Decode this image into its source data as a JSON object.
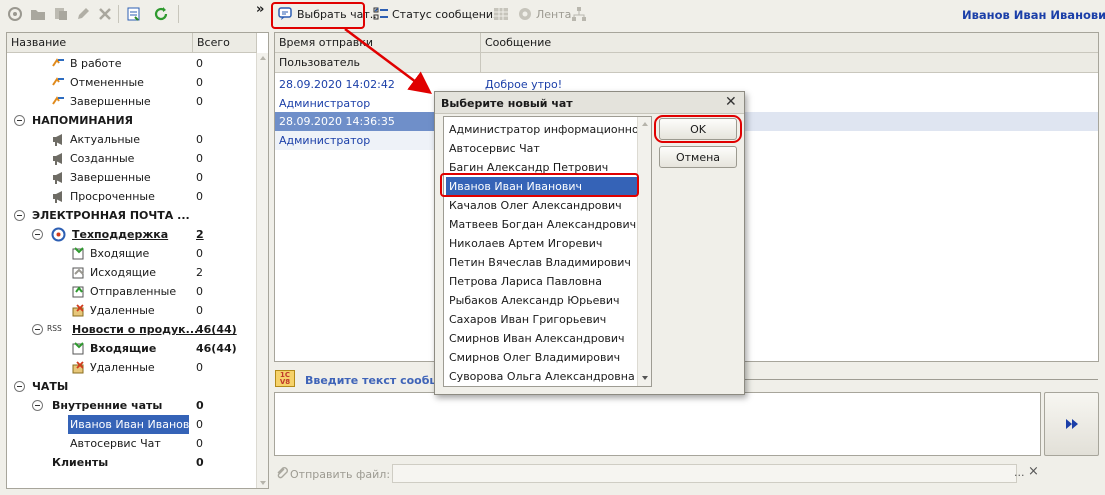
{
  "toolbar": {
    "choose_chat_label": "Выбрать чат..",
    "message_status_label": "Статус сообщения",
    "feed_label": "Лента",
    "more_glyph": "»",
    "user_name": "Иванов Иван Иванович"
  },
  "left_panel": {
    "col_name": "Название",
    "col_total": "Всего",
    "rows": [
      {
        "label": "В работе",
        "count": "0"
      },
      {
        "label": "Отмененные",
        "count": "0"
      },
      {
        "label": "Завершенные",
        "count": "0"
      },
      {
        "label": "НАПОМИНАНИЯ",
        "count": ""
      },
      {
        "label": "Актуальные",
        "count": "0"
      },
      {
        "label": "Созданные",
        "count": "0"
      },
      {
        "label": "Завершенные",
        "count": "0"
      },
      {
        "label": "Просроченные",
        "count": "0"
      },
      {
        "label": "ЭЛЕКТРОННАЯ ПОЧТА ...",
        "count": ""
      },
      {
        "label": "Техподдержка",
        "count": "2"
      },
      {
        "label": "Входящие",
        "count": "0"
      },
      {
        "label": "Исходящие",
        "count": "2"
      },
      {
        "label": "Отправленные",
        "count": "0"
      },
      {
        "label": "Удаленные",
        "count": "0"
      },
      {
        "label": "Новости о продук...",
        "count": "46(44)"
      },
      {
        "label": "Входящие",
        "count": "46(44)"
      },
      {
        "label": "Удаленные",
        "count": "0"
      },
      {
        "label": "ЧАТЫ",
        "count": ""
      },
      {
        "label": "Внутренние чаты",
        "count": "0"
      },
      {
        "label": "Иванов Иван Иванов...",
        "count": "0"
      },
      {
        "label": "Автосервис Чат",
        "count": "0"
      },
      {
        "label": "Клиенты",
        "count": "0"
      }
    ],
    "rss_label": "RSS"
  },
  "grid": {
    "col_time": "Время отправки",
    "col_user": "Пользователь",
    "col_message": "Сообщение",
    "messages": [
      {
        "time": "28.09.2020 14:02:42",
        "user": "Администратор",
        "text": "Доброе утро!"
      },
      {
        "time": "28.09.2020 14:36:35",
        "user": "Администратор",
        "text": ""
      }
    ]
  },
  "compose": {
    "placeholder": "Введите текст сообщ",
    "attach_label": "Отправить файл:",
    "attach_dots": "...",
    "close_glyph": "×"
  },
  "dialog": {
    "title": "Выберите новый чат",
    "close_glyph": "✕",
    "ok_label": "OK",
    "cancel_label": "Отмена",
    "selected_index": 3,
    "items": [
      "Администратор информационной ...",
      "Автосервис Чат",
      "Багин Александр Петрович",
      "Иванов Иван Иванович",
      "Качалов Олег Александрович",
      "Матвеев Богдан Александрович",
      "Николаев Артем Игоревич",
      "Петин Вячеслав Владимирович",
      "Петрова Лариса Павловна",
      "Рыбаков Александр Юрьевич",
      "Сахаров Иван Григорьевич",
      "Смирнов Иван Александрович",
      "Смирнов Олег Владимирович",
      "Суворова Ольга Александровна"
    ]
  },
  "colors": {
    "accent_blue": "#1b3fa8",
    "selection_blue": "#3563b7",
    "highlight_red": "#e00000"
  }
}
